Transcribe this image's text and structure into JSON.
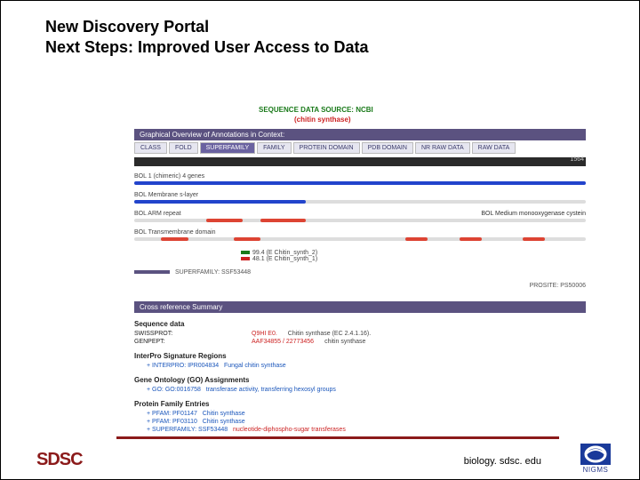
{
  "title_line1": "New Discovery Portal",
  "title_line2": "Next Steps: Improved User Access to Data",
  "header": {
    "source_label": "SEQUENCE DATA SOURCE: NCBI",
    "protein": "(chitin synthase)"
  },
  "panel_graphical": "Graphical Overview of Annotations in Context:",
  "tabs": [
    "CLASS",
    "FOLD",
    "SUPERFAMILY",
    "FAMILY",
    "PROTEIN DOMAIN",
    "PDB DOMAIN",
    "NR RAW DATA",
    "RAW DATA"
  ],
  "active_tab": 2,
  "scale_end": "1564",
  "tracks": [
    {
      "label": "BOL 1 (chimeric) 4 genes",
      "segs": [
        {
          "l": 0,
          "w": 100,
          "cls": "blue"
        }
      ]
    },
    {
      "label": "BOL Membrane s-layer",
      "segs": [
        {
          "l": 0,
          "w": 38,
          "cls": "blue"
        }
      ]
    },
    {
      "label": "BOL ARM repeat",
      "segs": [
        {
          "l": 16,
          "w": 8,
          "cls": "red"
        },
        {
          "l": 28,
          "w": 10,
          "cls": "red"
        }
      ],
      "right": "BOL Medium monooxygenase cystein"
    },
    {
      "label": "BOL Transmembrane domain",
      "segs": [
        {
          "l": 6,
          "w": 6,
          "cls": "red"
        },
        {
          "l": 22,
          "w": 6,
          "cls": "red"
        },
        {
          "l": 60,
          "w": 5,
          "cls": "red"
        },
        {
          "l": 72,
          "w": 5,
          "cls": "red"
        },
        {
          "l": 86,
          "w": 5,
          "cls": "red"
        }
      ]
    }
  ],
  "legend": {
    "a": "99.4 (E Chitin_synth_2)",
    "b": "48.1 (E Chitin_synth_1)"
  },
  "dbhits": {
    "superfamily": "SUPERFAMILY: SSF53448",
    "prosite": "PROSITE: PS50006"
  },
  "xref_hdr": "Cross reference Summary",
  "seq_section": {
    "title": "Sequence data",
    "rows": [
      {
        "lbl": "SWISSPROT:",
        "val": "Q9HI E0.",
        "desc": "Chitin synthase (EC 2.4.1.16)."
      },
      {
        "lbl": "GENPEPT:",
        "val": "AAF34855 / 22773456",
        "desc": "chitin synthase"
      }
    ]
  },
  "interpro_section": {
    "title": "InterPro Signature Regions",
    "item": "INTERPRO: IPR004834",
    "desc": "Fungal chitin synthase"
  },
  "go_section": {
    "title": "Gene Ontology (GO) Assignments",
    "item": "GO: GO:0016758",
    "desc": "transferase activity, transferring hexosyl groups"
  },
  "pfam_section": {
    "title": "Protein Family Entries",
    "rows": [
      {
        "lbl": "PFAM: PF01147",
        "desc": "Chitin synthase"
      },
      {
        "lbl": "PFAM: PF03110",
        "desc": "Chitin synthase"
      },
      {
        "lbl": "SUPERFAMILY: SSF53448",
        "desc": "nucleotide-diphospho-sugar transferases"
      }
    ]
  },
  "footer": {
    "logo": "SDSC",
    "url": "biology. sdsc. edu",
    "nigms": "NIGMS"
  }
}
